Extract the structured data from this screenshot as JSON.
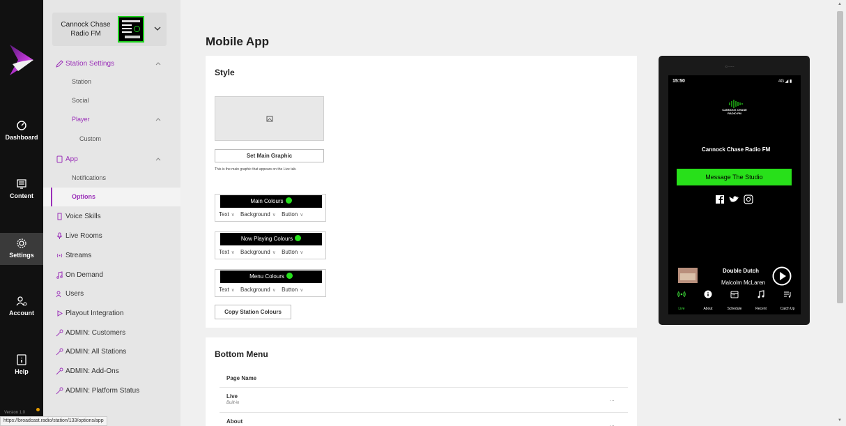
{
  "rail": {
    "items": [
      {
        "label": "Dashboard",
        "icon": "gauge-icon"
      },
      {
        "label": "Content",
        "icon": "content-icon"
      },
      {
        "label": "Settings",
        "icon": "gear-icon"
      },
      {
        "label": "Account",
        "icon": "account-icon"
      },
      {
        "label": "Help",
        "icon": "help-book-icon"
      }
    ],
    "version": "Version 1.0"
  },
  "station_picker": {
    "name": "Cannock Chase Radio FM"
  },
  "nav": {
    "items": [
      {
        "label": "Station Settings",
        "icon": "pencil-icon"
      },
      {
        "label": "Station"
      },
      {
        "label": "Social"
      },
      {
        "label": "Player"
      },
      {
        "label": "Custom"
      },
      {
        "label": "App",
        "icon": "phone-icon"
      },
      {
        "label": "Notifications"
      },
      {
        "label": "Options"
      },
      {
        "label": "Voice Skills",
        "icon": "speaker-icon"
      },
      {
        "label": "Live Rooms",
        "icon": "mic-icon"
      },
      {
        "label": "Streams",
        "icon": "broadcast-icon"
      },
      {
        "label": "On Demand",
        "icon": "music-note-icon"
      },
      {
        "label": "Users",
        "icon": "users-icon"
      },
      {
        "label": "Playout Integration",
        "icon": "play-icon"
      },
      {
        "label": "ADMIN: Customers",
        "icon": "key-icon"
      },
      {
        "label": "ADMIN: All Stations",
        "icon": "key-icon"
      },
      {
        "label": "ADMIN: Add-Ons",
        "icon": "key-icon"
      },
      {
        "label": "ADMIN: Platform Status",
        "icon": "key-icon"
      }
    ]
  },
  "page": {
    "title": "Mobile App"
  },
  "style_card": {
    "title": "Style",
    "set_graphic_label": "Set Main Graphic",
    "helper": "This is the main graphic that appears on the Live tab.",
    "colour_groups": [
      {
        "title": "Main Colours",
        "options": [
          "Text",
          "Background",
          "Button"
        ]
      },
      {
        "title": "Now Playing Colours",
        "options": [
          "Text",
          "Background",
          "Button"
        ]
      },
      {
        "title": "Menu Colours",
        "options": [
          "Text",
          "Background",
          "Button"
        ]
      }
    ],
    "copy_label": "Copy Station Colours",
    "accent_color": "#26e01c"
  },
  "bottom_menu": {
    "title": "Bottom Menu",
    "column_header": "Page Name",
    "rows": [
      {
        "name": "Live",
        "type": "Built-in",
        "menu": "..."
      },
      {
        "name": "About",
        "menu": "..."
      }
    ]
  },
  "phone": {
    "notch": "o -----",
    "time": "15:50",
    "signal": "4G",
    "logo_lines": [
      "CANNOCK CHASE",
      "RADIO FM"
    ],
    "station_title": "Cannock Chase Radio FM",
    "message_button": "Message The Studio",
    "now_playing": {
      "track": "Double Dutch",
      "artist": "Malcolm McLaren"
    },
    "tabs": [
      {
        "label": "Live",
        "icon": "live-icon"
      },
      {
        "label": "About",
        "icon": "info-icon"
      },
      {
        "label": "Schedule",
        "icon": "calendar-icon"
      },
      {
        "label": "Recent",
        "icon": "music-note-icon"
      },
      {
        "label": "Catch Up",
        "icon": "playlist-icon"
      }
    ]
  },
  "status_url": "https://broadcast.radio/station/133/options/app"
}
